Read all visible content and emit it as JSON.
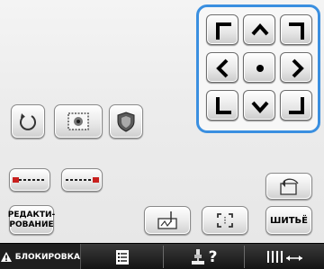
{
  "buttons": {
    "edit_line1": "РЕДАКТИ-",
    "edit_line2": "РОВАНИЕ",
    "sew": "ШИТЬЁ"
  },
  "statusbar": {
    "lock_label": "БЛОКИРОВКА",
    "help_label": "?"
  },
  "colors": {
    "accent": "#3a8fe0",
    "marker": "#c8201e",
    "lock_tab_bg": "#1f1f1f"
  }
}
